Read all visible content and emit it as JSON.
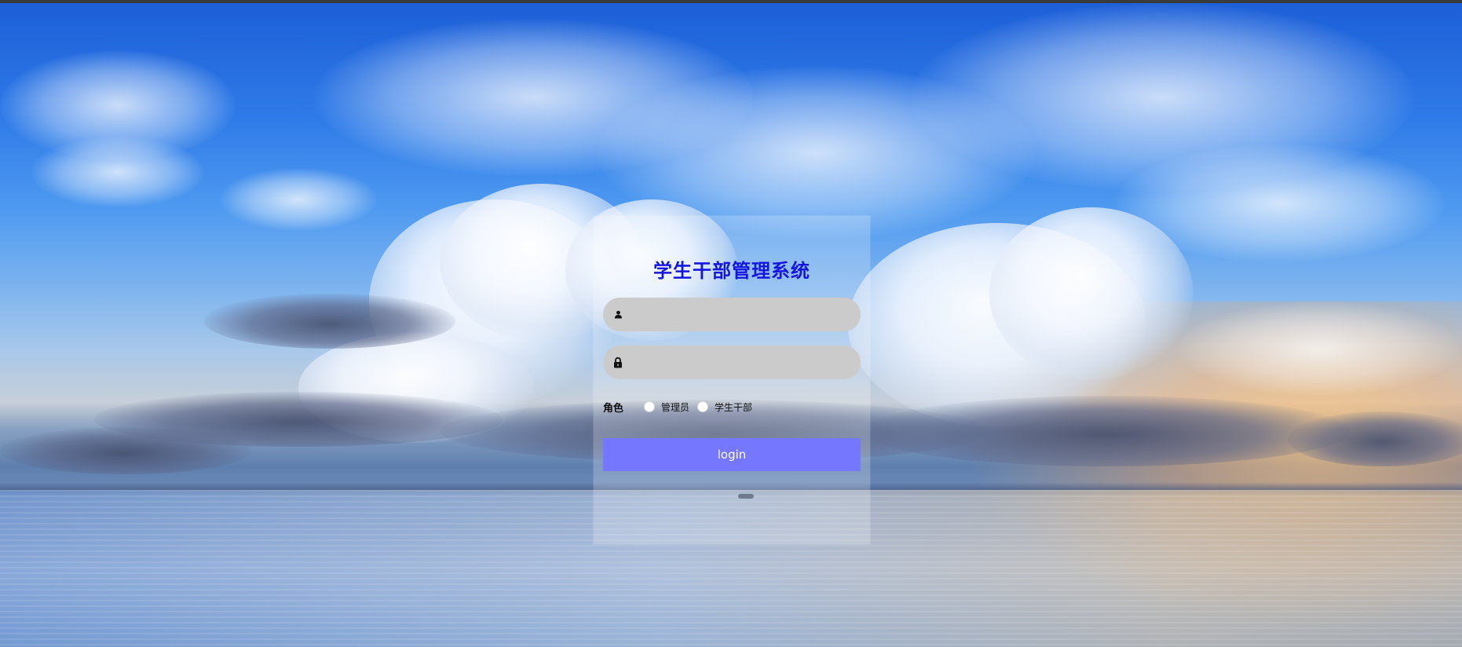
{
  "login": {
    "title": "学生干部管理系统",
    "username_placeholder": "",
    "password_placeholder": "",
    "role_label": "角色",
    "role_options": [
      "管理员",
      "学生干部"
    ],
    "login_button": "login"
  },
  "icons": {
    "username": "user-icon",
    "password": "lock-icon"
  },
  "colors": {
    "title": "#1515e0",
    "button": "#7677ff",
    "input_bg": "#cbcbcb"
  }
}
